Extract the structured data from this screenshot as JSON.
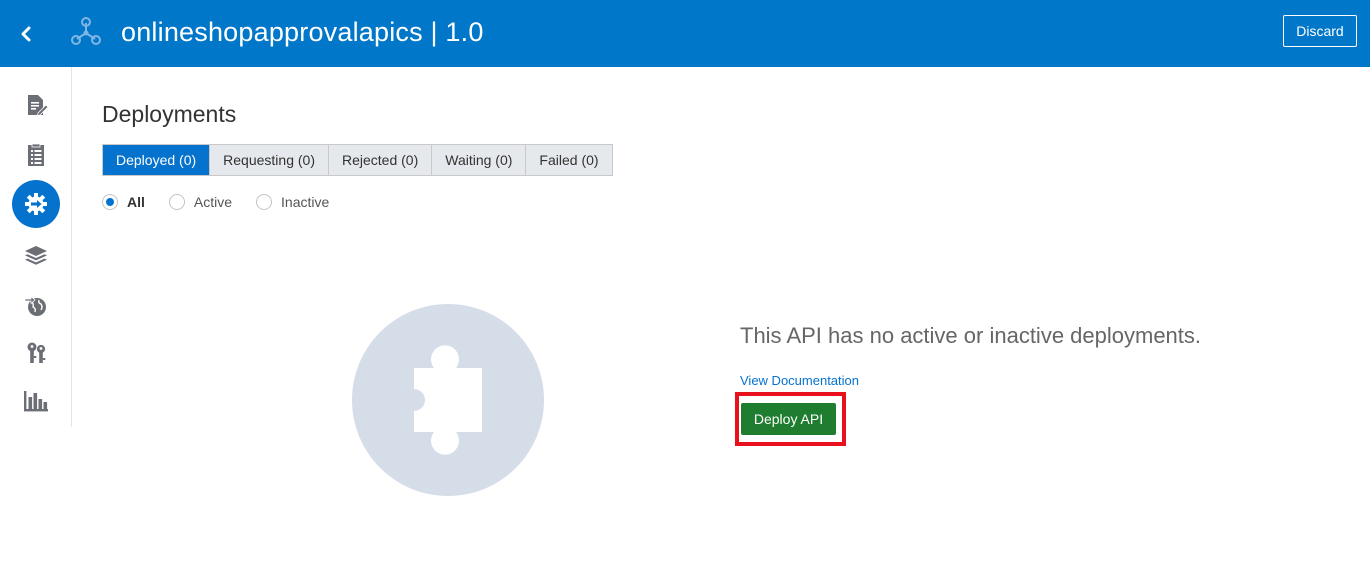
{
  "header": {
    "title": "onlineshopapprovalapics | 1.0",
    "discard_label": "Discard",
    "background": "#0077c8",
    "back_icon": "chevron-left-icon",
    "api_icon": "api-nodes-icon"
  },
  "sidebar": {
    "items": [
      {
        "name": "api-implementation-icon",
        "active": false
      },
      {
        "name": "api-details-icon",
        "active": false
      },
      {
        "name": "deployments-icon",
        "active": true
      },
      {
        "name": "plans-icon",
        "active": false
      },
      {
        "name": "publication-icon",
        "active": false
      },
      {
        "name": "grants-icon",
        "active": false
      },
      {
        "name": "analytics-icon",
        "active": false
      }
    ],
    "active_color": "#0572ce"
  },
  "main": {
    "title": "Deployments",
    "tabs": [
      {
        "label": "Deployed (0)",
        "active": true
      },
      {
        "label": "Requesting (0)",
        "active": false
      },
      {
        "label": "Rejected (0)",
        "active": false
      },
      {
        "label": "Waiting (0)",
        "active": false
      },
      {
        "label": "Failed (0)",
        "active": false
      }
    ],
    "filters": [
      {
        "label": "All",
        "checked": true
      },
      {
        "label": "Active",
        "checked": false
      },
      {
        "label": "Inactive",
        "checked": false
      }
    ],
    "empty_state": {
      "icon": "puzzle-piece-icon",
      "message": "This API has no active or inactive deployments.",
      "link_label": "View Documentation",
      "button_label": "Deploy API",
      "button_color": "#1e7d2e",
      "highlight_color": "#e8101c"
    }
  }
}
